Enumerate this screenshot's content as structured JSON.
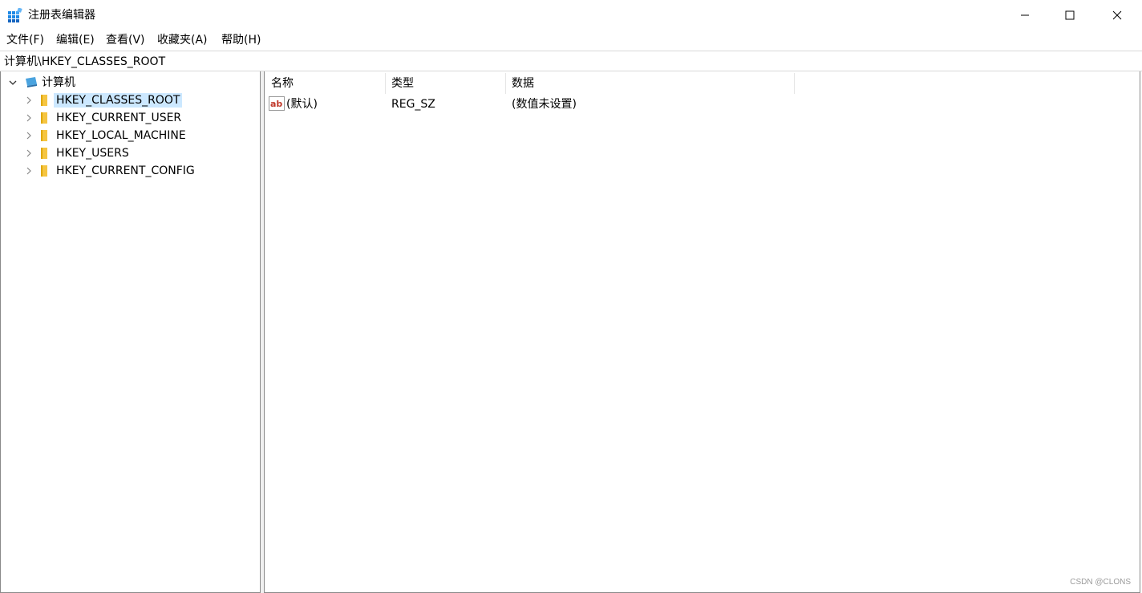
{
  "window": {
    "title": "注册表编辑器",
    "controls": [
      "minimize",
      "maximize",
      "close"
    ]
  },
  "menu": {
    "items": [
      {
        "label": "文件(F)"
      },
      {
        "label": "编辑(E)"
      },
      {
        "label": "查看(V)"
      },
      {
        "label": "收藏夹(A)"
      },
      {
        "label": "帮助(H)"
      }
    ]
  },
  "address": {
    "path": "计算机\\HKEY_CLASSES_ROOT"
  },
  "tree": {
    "root": {
      "label": "计算机",
      "expanded": true
    },
    "children": [
      {
        "label": "HKEY_CLASSES_ROOT",
        "selected": true
      },
      {
        "label": "HKEY_CURRENT_USER",
        "selected": false
      },
      {
        "label": "HKEY_LOCAL_MACHINE",
        "selected": false
      },
      {
        "label": "HKEY_USERS",
        "selected": false
      },
      {
        "label": "HKEY_CURRENT_CONFIG",
        "selected": false
      }
    ]
  },
  "list": {
    "columns": [
      {
        "label": "名称"
      },
      {
        "label": "类型"
      },
      {
        "label": "数据"
      }
    ],
    "rows": [
      {
        "name": "(默认)",
        "type": "REG_SZ",
        "data": "(数值未设置)",
        "icon": "string-value-icon"
      }
    ]
  },
  "watermark": "CSDN @CLONS",
  "colors": {
    "selection": "#cce8ff",
    "folder": "#f5c542",
    "app_icon": "#1e88e5"
  }
}
